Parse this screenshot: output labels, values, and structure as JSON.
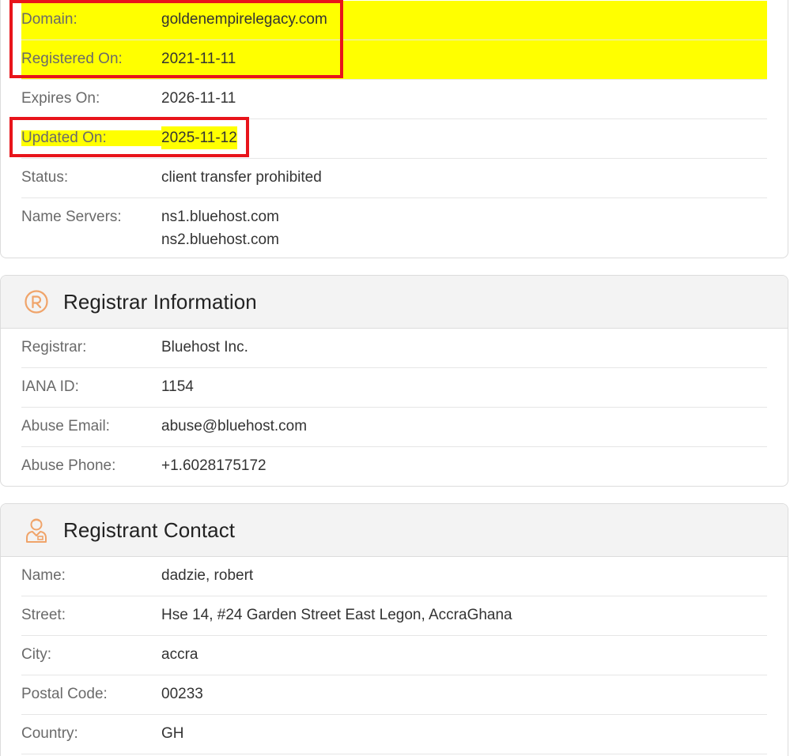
{
  "domain_section": {
    "rows": [
      {
        "label": "Domain:",
        "value": "goldenempirelegacy.com"
      },
      {
        "label": "Registered On:",
        "value": "2021-11-11"
      },
      {
        "label": "Expires On:",
        "value": "2026-11-11"
      },
      {
        "label": "Updated On:",
        "value": "2025-11-12"
      },
      {
        "label": "Status:",
        "value": "client transfer prohibited"
      },
      {
        "label": "Name Servers:",
        "values": [
          "ns1.bluehost.com",
          "ns2.bluehost.com"
        ]
      }
    ],
    "highlight_color": "#ffff00",
    "annotation_color": "#e8141b"
  },
  "registrar_section": {
    "title": "Registrar Information",
    "icon": "registered-trademark-icon",
    "rows": [
      {
        "label": "Registrar:",
        "value": "Bluehost Inc."
      },
      {
        "label": "IANA ID:",
        "value": "1154"
      },
      {
        "label": "Abuse Email:",
        "value": "abuse@bluehost.com"
      },
      {
        "label": "Abuse Phone:",
        "value": "+1.6028175172"
      }
    ]
  },
  "registrant_section": {
    "title": "Registrant Contact",
    "icon": "person-badge-icon",
    "rows": [
      {
        "label": "Name:",
        "value": "dadzie, robert"
      },
      {
        "label": "Street:",
        "value": "Hse 14, #24 Garden Street East Legon, AccraGhana"
      },
      {
        "label": "City:",
        "value": "accra"
      },
      {
        "label": "Postal Code:",
        "value": "00233"
      },
      {
        "label": "Country:",
        "value": "GH"
      }
    ]
  },
  "accent_color": "#f0a46a"
}
